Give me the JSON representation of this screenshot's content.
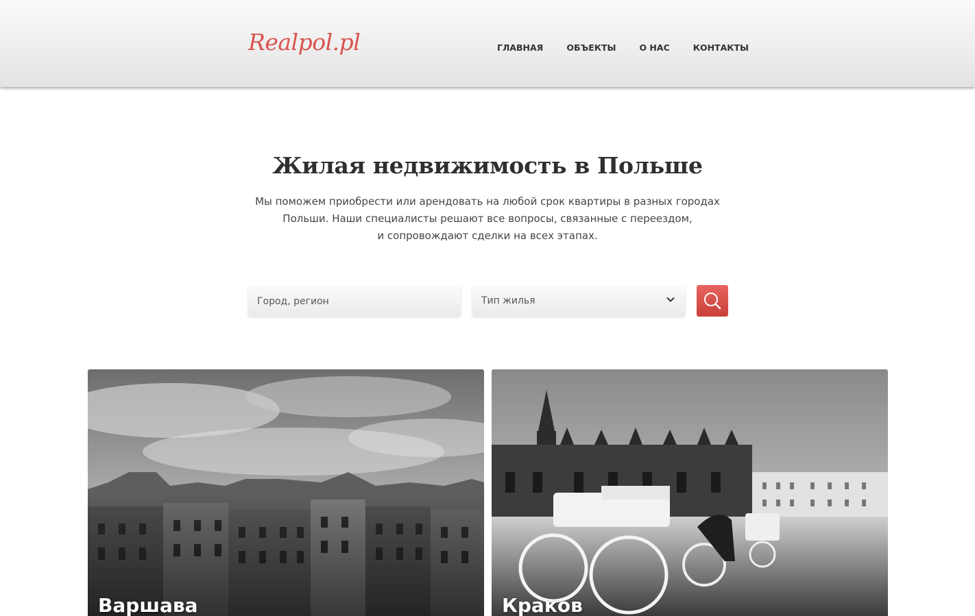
{
  "header": {
    "logo": "Realpol.pl",
    "nav": [
      "ГЛАВНАЯ",
      "ОБЪЕКТЫ",
      "О НАС",
      "КОНТАКТЫ"
    ]
  },
  "hero": {
    "title": "Жилая недвижимость в Польше",
    "description_lines": [
      "Мы поможем приобрести или арендовать на любой срок квартиры в разных городах",
      "Польши. Наши специалисты решают все вопросы, связанные с переездом,",
      "и сопровождают сделки на всех этапах."
    ]
  },
  "search": {
    "city_placeholder": "Город, регион",
    "type_selected": "Тип жилья",
    "button_icon": "search-icon"
  },
  "cards": [
    {
      "city": "Варшава"
    },
    {
      "city": "Краков"
    }
  ],
  "colors": {
    "accent": "#d9534f",
    "button": "#d84a44",
    "text": "#333333"
  }
}
